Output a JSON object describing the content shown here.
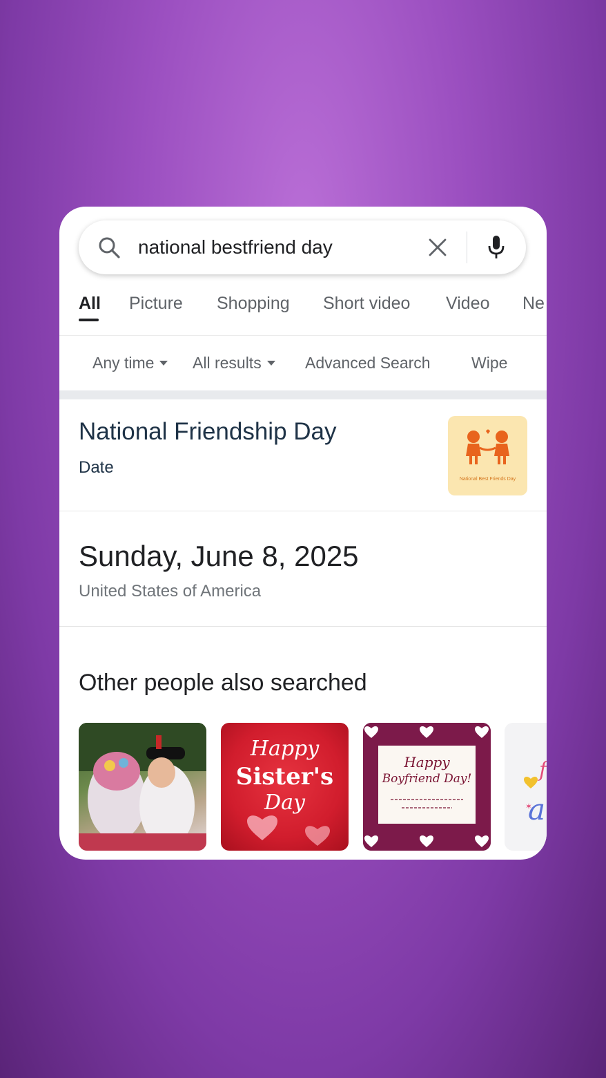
{
  "search": {
    "query": "national bestfriend day"
  },
  "icons": {
    "search": "search-icon",
    "clear": "close-icon",
    "voice": "microphone-icon"
  },
  "tabs": [
    {
      "label": "All",
      "active": true
    },
    {
      "label": "Picture"
    },
    {
      "label": "Shopping"
    },
    {
      "label": "Short video"
    },
    {
      "label": "Video"
    },
    {
      "label": "Ne"
    }
  ],
  "filters": {
    "any_time": "Any time",
    "all_results": "All results",
    "advanced_search": "Advanced Search",
    "wipe": "Wipe"
  },
  "knowledge_panel": {
    "title": "National Friendship Day",
    "subtitle": "Date",
    "thumb_caption": "National Best Friends Day"
  },
  "answer": {
    "date": "Sunday, June 8, 2025",
    "location": "United States of America"
  },
  "related": {
    "title": "Other people also searched",
    "items": [
      {
        "text": ""
      },
      {
        "line1": "Happy",
        "line2": "Sister's",
        "line3": "Day"
      },
      {
        "line1": "Happy",
        "line2": "Boyfriend Day!"
      },
      {
        "text": ""
      }
    ]
  },
  "colors": {
    "background": "#9b4fc0",
    "card": "#ffffff",
    "title_blue": "#1f3347"
  }
}
